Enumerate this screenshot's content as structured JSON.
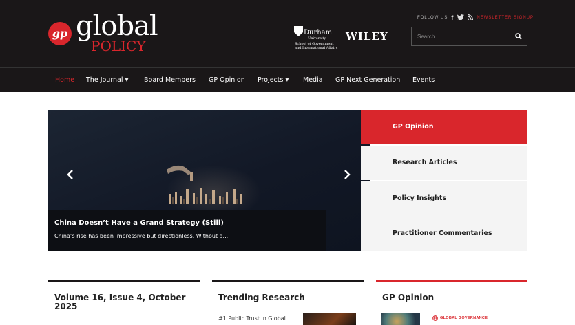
{
  "brand": {
    "logo_mark": "gp",
    "logo_word": "global",
    "logo_sub": "POLICY",
    "accent_color": "#d9262c",
    "header_bg": "#1a1718"
  },
  "partners": {
    "durham_name": "Durham",
    "durham_univ": "University",
    "durham_school_1": "School of Government",
    "durham_school_2": "and International Affairs",
    "wiley": "WILEY"
  },
  "topbar": {
    "follow_label": "FOLLOW US",
    "social_icons": [
      "facebook-icon",
      "twitter-icon",
      "rss-icon"
    ],
    "newsletter_label": "NEWSLETTER SIGNUP"
  },
  "search": {
    "placeholder": "Search",
    "icon": "search-icon"
  },
  "nav": {
    "items": [
      {
        "label": "Home",
        "active": true
      },
      {
        "label": "The Journal ▾"
      },
      {
        "label": "Board Members"
      },
      {
        "label": "GP Opinion"
      },
      {
        "label": "Projects ▾"
      },
      {
        "label": "Media"
      },
      {
        "label": "GP Next Generation"
      },
      {
        "label": "Events"
      }
    ]
  },
  "hero": {
    "title": "China Doesn’t Have a Grand Strategy (Still)",
    "description": "China’s rise has been impressive but directionless. Without a...",
    "prev_icon": "chevron-left-icon",
    "next_icon": "chevron-right-icon"
  },
  "tabs": [
    {
      "label": "GP Opinion",
      "active": true
    },
    {
      "label": "Research Articles"
    },
    {
      "label": "Policy Insights"
    },
    {
      "label": "Practitioner Commentaries"
    }
  ],
  "cards": {
    "volume_title": "Volume 16, Issue 4, October 2025",
    "trending_title": "Trending Research",
    "trending_item": "#1 Public Trust in Global",
    "opinion_title": "GP Opinion",
    "opinion_tag": "GLOBAL GOVERNANCE",
    "opinion_tag_icon": "globe-icon"
  }
}
